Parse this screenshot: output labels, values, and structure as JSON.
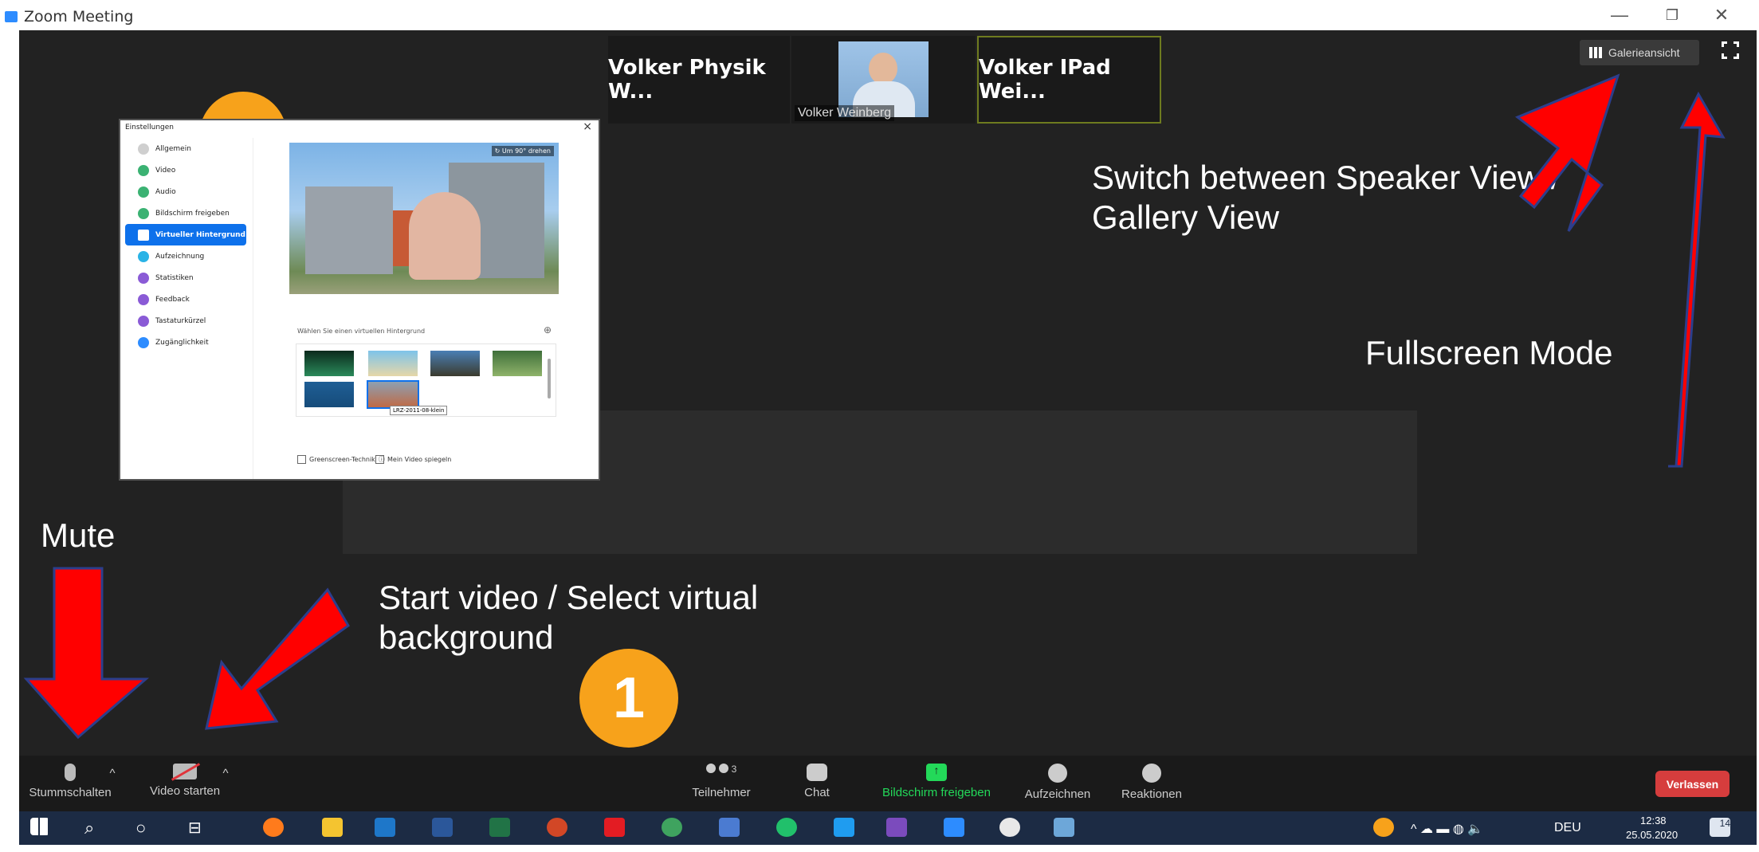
{
  "window": {
    "title": "Zoom Meeting",
    "minimize": "—",
    "restore": "❐",
    "close": "✕"
  },
  "thumbnails": [
    {
      "name": "Volker Physik W..."
    },
    {
      "name": "Volker Weinberg"
    },
    {
      "name": "Volker IPad Wei..."
    }
  ],
  "gallery_button": {
    "label": "Galerieansicht",
    "icon": "grid-icon"
  },
  "annotations": {
    "gallery": "Switch between Speaker View / Gallery View",
    "fullscreen": "Fullscreen Mode",
    "mute": "Mute",
    "video": "Start video / Select virtual background",
    "badge": "1"
  },
  "settings": {
    "title": "Einstellungen",
    "close": "×",
    "items": [
      {
        "label": "Allgemein",
        "color": "#cfcfcf"
      },
      {
        "label": "Video",
        "color": "#3bb273"
      },
      {
        "label": "Audio",
        "color": "#3bb273"
      },
      {
        "label": "Bildschirm freigeben",
        "color": "#3bb273"
      },
      {
        "label": "Virtueller Hintergrund",
        "color": "#ffffff"
      },
      {
        "label": "Aufzeichnung",
        "color": "#2ab3e6"
      },
      {
        "label": "Statistiken",
        "color": "#8a5bd6"
      },
      {
        "label": "Feedback",
        "color": "#8a5bd6"
      },
      {
        "label": "Tastaturkürzel",
        "color": "#8a5bd6"
      },
      {
        "label": "Zugänglichkeit",
        "color": "#2d8cff"
      }
    ],
    "rotate": "↻ Um 90° drehen",
    "choose_label": "Wählen Sie einen virtuellen Hintergrund",
    "tooltip": "LRZ-2011-08-klein",
    "greenscreen": "Greenscreen-Technik",
    "mirror": "Mein Video spiegeln"
  },
  "toolbar": {
    "mute": "Stummschalten",
    "video": "Video starten",
    "participants": "Teilnehmer",
    "participants_count": "3",
    "chat": "Chat",
    "share": "Bildschirm freigeben",
    "record": "Aufzeichnen",
    "reactions": "Reaktionen",
    "leave": "Verlassen"
  },
  "taskbar": {
    "lang": "DEU",
    "time": "12:38",
    "date": "25.05.2020",
    "notifications": "14"
  },
  "colors": {
    "share_green": "#23d959",
    "leave_red": "#d63d3d",
    "arrow_red": "#ff0000",
    "badge_orange": "#f7a21b"
  }
}
